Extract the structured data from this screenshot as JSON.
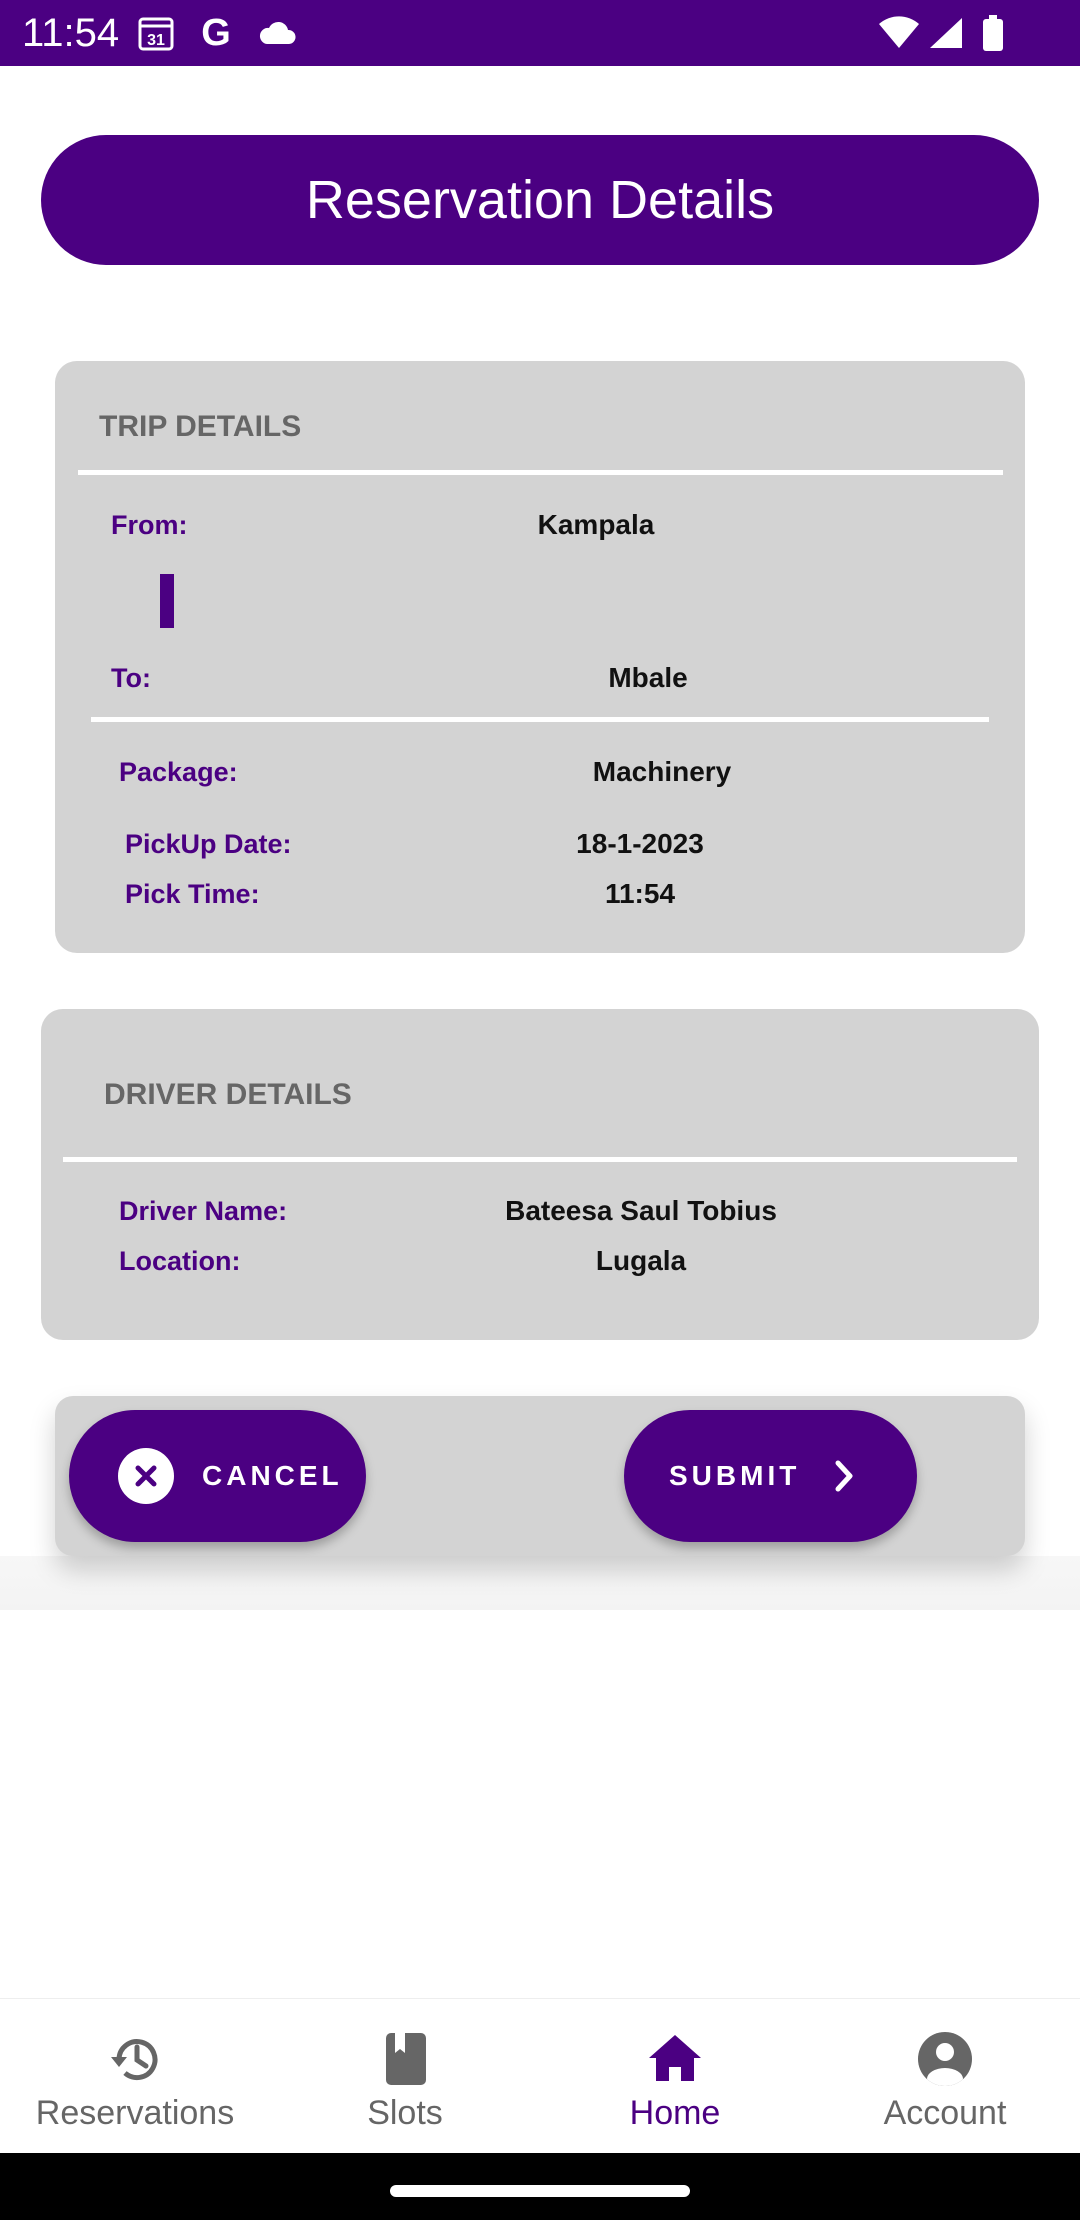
{
  "status_bar": {
    "time": "11:54",
    "calendar_day": "31",
    "google_letter": "G",
    "background_color": "#4b0082"
  },
  "header": {
    "title": "Reservation Details"
  },
  "trip_details": {
    "title": "TRIP DETAILS",
    "from_label": "From:",
    "from_value": "Kampala",
    "to_label": "To:",
    "to_value": "Mbale",
    "package_label": "Package:",
    "package_value": "Machinery",
    "pickup_date_label": "PickUp Date:",
    "pickup_date_value": "18-1-2023",
    "pick_time_label": "Pick Time:",
    "pick_time_value": "11:54"
  },
  "driver_details": {
    "title": "DRIVER DETAILS",
    "name_label": "Driver Name:",
    "name_value": "Bateesa Saul Tobius",
    "location_label": "Location:",
    "location_value": "Lugala"
  },
  "actions": {
    "cancel_label": "CANCEL",
    "submit_label": "SUBMIT"
  },
  "bottom_nav": {
    "items": [
      {
        "label": "Reservations",
        "icon": "history-icon",
        "active": false
      },
      {
        "label": "Slots",
        "icon": "book-icon",
        "active": false
      },
      {
        "label": "Home",
        "icon": "home-icon",
        "active": true
      },
      {
        "label": "Account",
        "icon": "account-circle-icon",
        "active": false
      }
    ]
  },
  "colors": {
    "primary": "#4b0082",
    "card": "#d3d3d3",
    "section_title": "#666666",
    "inactive_nav": "#666666"
  }
}
